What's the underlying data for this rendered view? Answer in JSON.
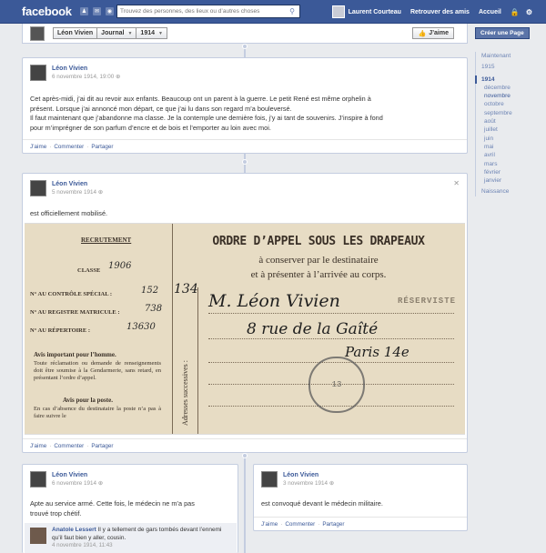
{
  "topbar": {
    "logo": "facebook",
    "search_placeholder": "Trouvez des personnes, des lieux ou d’autres choses",
    "user_name": "Laurent Courteau",
    "find_friends": "Retrouver des amis",
    "home": "Accueil"
  },
  "header": {
    "name": "Léon Vivien",
    "section": "Journal",
    "year": "1914",
    "like_label": "J’aime",
    "create_page": "Créer une Page"
  },
  "timeline_nav": {
    "now": "Maintenant",
    "y1915": "1915",
    "y1914": "1914",
    "months": [
      "décembre",
      "novembre",
      "octobre",
      "septembre",
      "août",
      "juillet",
      "juin",
      "mai",
      "avril",
      "mars",
      "février",
      "janvier"
    ],
    "birth": "Naissance"
  },
  "actions": {
    "like": "J’aime",
    "comment": "Commenter",
    "share": "Partager"
  },
  "posts": {
    "p1": {
      "author": "Léon Vivien",
      "date": "6 novembre 1914, 19:00",
      "text_l1": "Cet après-midi, j’ai dit au revoir aux enfants. Beaucoup ont un parent à la guerre. Le petit René est même orphelin à",
      "text_l2": "présent. Lorsque j’ai annoncé mon départ, ce que j’ai lu dans son regard m’a bouleversé.",
      "text_l3": "Il faut maintenant que j’abandonne ma classe. Je la contemple une dernière fois, j’y ai tant de souvenirs. J’inspire à fond",
      "text_l4": "pour m’imprégner de son parfum d’encre et de bois et l’emporter au loin avec moi."
    },
    "p2": {
      "author": "Léon Vivien",
      "date": "5 novembre 1914",
      "text": "est officiellement mobilisé.",
      "doc": {
        "recrutement": "RECRUTEMENT",
        "classe_label": "CLASSE",
        "classe_val": "1906",
        "controle_label": "N° AU CONTRÔLE SPÉCIAL :",
        "controle_val": "152",
        "matricule_label": "N° AU REGISTRE MATRICULE :",
        "matricule_val": "738",
        "repertoire_label": "N° AU RÉPERTOIRE :",
        "repertoire_val": "13630",
        "avis_title": "Avis important pour l’homme.",
        "avis_text": "Toute réclamation ou demande de renseignements doit être soumise à la Gendarmerie, sans retard, en présentant l’ordre d’appel.",
        "avis2_title": "Avis pour la poste.",
        "avis2_text": "En cas d’absence du destinataire la poste n’a pas à faire suivre le",
        "title": "ORDRE D’APPEL SOUS LES DRAPEAUX",
        "sub1": "à conserver par le destinataire",
        "sub2": "et à présenter à l’arrivée au corps.",
        "reserviste": "RÉSERVISTE",
        "addressee": "M. Léon Vivien",
        "street": "8 rue de la Gaîté",
        "city": "Paris 14e",
        "side_num": "134",
        "vertical": "Adresses successives :"
      }
    },
    "p3": {
      "author": "Léon Vivien",
      "date": "6 novembre 1914",
      "text_l1": "Apte au service armé. Cette fois, le médecin ne m’a pas",
      "text_l2": "trouvé trop chétif.",
      "comment": {
        "author": "Anatole Lessert",
        "text": "Il y a tellement de gars tombés devant l’ennemi qu’il faut bien y aller, cousin.",
        "date": "4 novembre 1914, 11:43"
      }
    },
    "p4": {
      "author": "Léon Vivien",
      "date": "3 novembre 1914",
      "text": "est convoqué devant le médecin militaire."
    }
  }
}
